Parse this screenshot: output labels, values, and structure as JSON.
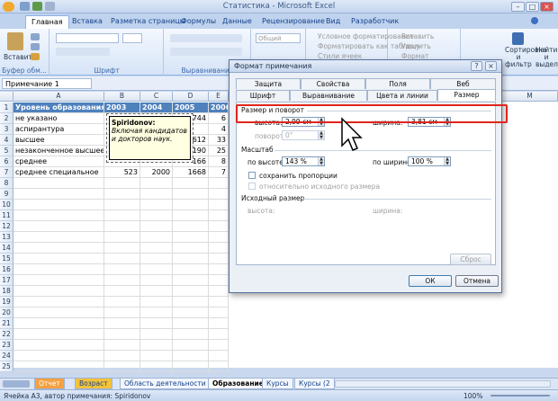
{
  "window": {
    "title": "Статистика - Microsoft Excel"
  },
  "ribbon": {
    "tabs": [
      "Главная",
      "Вставка",
      "Разметка страницы",
      "Формулы",
      "Данные",
      "Рецензирование",
      "Вид",
      "Разработчик"
    ],
    "active_tab": "Главная",
    "paste_label": "Вставить",
    "groups": {
      "clipboard": "Буфер обм...",
      "font": "Шрифт",
      "alignment": "Выравнивание",
      "number_format": "Общий"
    },
    "styles": {
      "conditional": "Условное форматирование",
      "as_table": "Форматировать как таблицу",
      "cell_styles": "Стили ячеек"
    },
    "cells": {
      "insert": "Вставить",
      "delete": "Удалить",
      "format": "Формат"
    },
    "editing": {
      "sort": "Сортировка и фильтр",
      "find": "Найти и выделить"
    }
  },
  "formula_bar": {
    "name_box": "Примечание 1"
  },
  "sheet": {
    "columns": [
      "A",
      "B",
      "C",
      "D",
      "E",
      "M"
    ],
    "rows": [
      "1",
      "2",
      "3",
      "4",
      "5",
      "6",
      "7",
      "8",
      "9",
      "10",
      "11",
      "12",
      "13",
      "14",
      "15",
      "16",
      "17",
      "18",
      "19",
      "20",
      "21",
      "22",
      "23",
      "24",
      "25"
    ],
    "header": [
      "Уровень образования",
      "2003",
      "2004",
      "2005",
      "2006"
    ],
    "data": [
      [
        "не указано",
        "",
        "",
        "744",
        "6"
      ],
      [
        "аспирантура",
        "",
        "",
        "",
        "4"
      ],
      [
        "высшее",
        "",
        "",
        "612",
        "33"
      ],
      [
        "незаконченное высшее",
        "",
        "",
        "190",
        "25"
      ],
      [
        "среднее",
        "",
        "",
        "166",
        "8"
      ],
      [
        "среднее специальное",
        "523",
        "2000",
        "1668",
        "7"
      ]
    ]
  },
  "comment": {
    "author": "Spiridonov:",
    "text": "Включая кандидатов и докторов наук."
  },
  "sheet_tabs": [
    "Отчет",
    "Возраст",
    "Область деятельности",
    "Образование",
    "Курсы",
    "Курсы (2"
  ],
  "active_sheet": "Образование",
  "status": {
    "text": "Ячейка А3, автор примечания: Spiridonov",
    "zoom": "100%"
  },
  "dialog": {
    "title": "Формат примечания",
    "tabs_top": [
      "Защита",
      "Свойства",
      "Поля",
      "Веб"
    ],
    "tabs_bottom": [
      "Шрифт",
      "Выравнивание",
      "Цвета и линии",
      "Размер"
    ],
    "active_tab": "Размер",
    "size_section": "Размер и поворот",
    "height_label": "высота:",
    "height_value": "2,99 см",
    "width_label": "ширина:",
    "width_value": "3,81 см",
    "rotation_label": "поворот:",
    "rotation_value": "0°",
    "scale_section": "Масштаб",
    "scale_height_label": "по высоте:",
    "scale_height_value": "143 %",
    "scale_width_label": "по ширине:",
    "scale_width_value": "100 %",
    "keep_proportions": "сохранить пропорции",
    "relative_original": "относительно исходного размера",
    "original_section": "Исходный размер",
    "orig_height": "высота:",
    "orig_width": "ширина:",
    "reset": "Сброс",
    "ok": "ОК",
    "cancel": "Отмена"
  }
}
